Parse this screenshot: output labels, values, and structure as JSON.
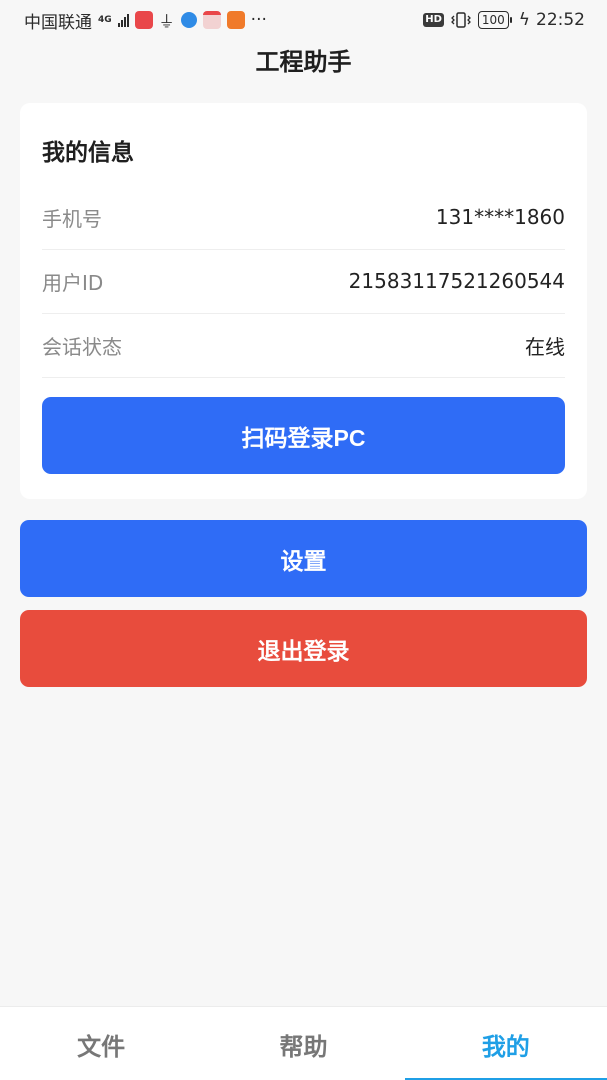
{
  "status_bar": {
    "carrier": "中国联通",
    "network": "4G",
    "more": "···",
    "hd": "HD",
    "battery": "100",
    "time": "22:52"
  },
  "header": {
    "title": "工程助手"
  },
  "card": {
    "title": "我的信息",
    "rows": [
      {
        "label": "手机号",
        "value": "131****1860"
      },
      {
        "label": "用户ID",
        "value": "2158311752126054 4"
      },
      {
        "label": "会话状态",
        "value": "在线"
      }
    ],
    "scan_button": "扫码登录PC"
  },
  "actions": {
    "settings": "设置",
    "logout": "退出登录"
  },
  "tabs": [
    {
      "label": "文件",
      "active": false
    },
    {
      "label": "帮助",
      "active": false
    },
    {
      "label": "我的",
      "active": true
    }
  ],
  "colors": {
    "primary": "#2f6cf6",
    "danger": "#e84c3d",
    "tab_active": "#1f9fe6"
  },
  "icons": [
    "signal-icon",
    "app-notification-icon",
    "usb-icon",
    "browser-icon",
    "mail-icon",
    "app-icon",
    "vibrate-icon",
    "charging-icon"
  ]
}
